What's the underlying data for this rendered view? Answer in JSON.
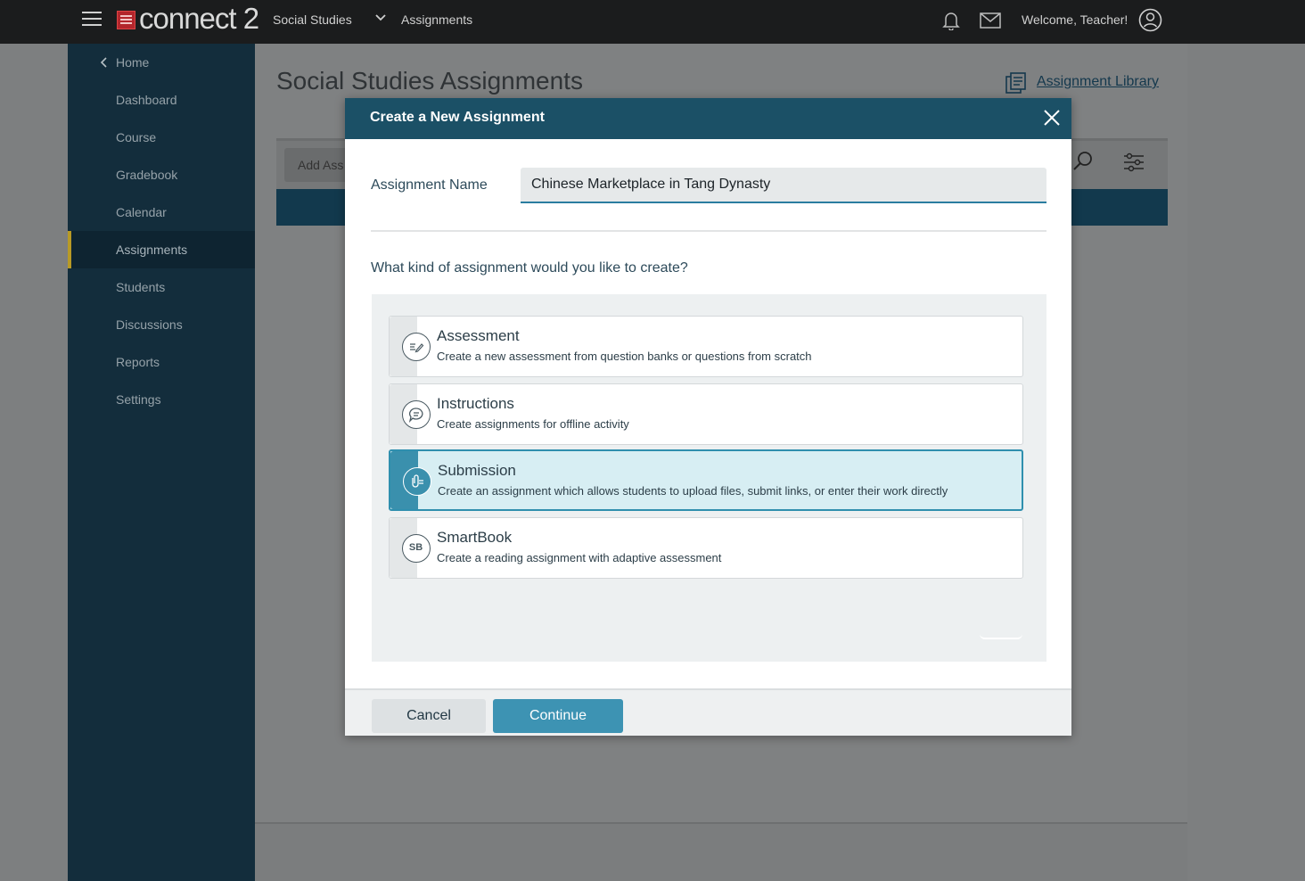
{
  "topbar": {
    "logo_text": "connect 2",
    "course": "Social Studies",
    "breadcrumb": "Assignments",
    "welcome": "Welcome, Teacher!"
  },
  "sidebar": {
    "items": [
      {
        "label": "Home"
      },
      {
        "label": "Dashboard"
      },
      {
        "label": "Course"
      },
      {
        "label": "Gradebook"
      },
      {
        "label": "Calendar"
      },
      {
        "label": "Assignments",
        "active": true
      },
      {
        "label": "Students"
      },
      {
        "label": "Discussions"
      },
      {
        "label": "Reports"
      },
      {
        "label": "Settings"
      }
    ]
  },
  "main": {
    "title": "Social Studies Assignments",
    "library_link": "Assignment Library",
    "add_button": "Add Ass"
  },
  "modal": {
    "title": "Create a New Assignment",
    "name_label": "Assignment Name",
    "name_value": "Chinese Marketplace in Tang Dynasty",
    "question": "What kind of assignment would you like to create?",
    "options": [
      {
        "title": "Assessment",
        "desc": "Create a new assessment from question banks or questions from scratch",
        "icon": "pencil-lines-icon"
      },
      {
        "title": "Instructions",
        "desc": "Create assignments for offline activity",
        "icon": "speech-bubble-icon"
      },
      {
        "title": "Submission",
        "desc": "Create an assignment which allows students to upload files, submit links, or enter their work directly",
        "icon": "paperclip-icon",
        "selected": true
      },
      {
        "title": "SmartBook",
        "desc": "Create a reading assignment with adaptive assessment",
        "icon": "smartbook-icon",
        "icon_text": "SB"
      }
    ],
    "cancel_label": "Cancel",
    "continue_label": "Continue"
  },
  "colors": {
    "header": "#1b5066",
    "accent": "#3d93b3",
    "sidebar": "#132d3c",
    "active_marker": "#b89a26"
  }
}
